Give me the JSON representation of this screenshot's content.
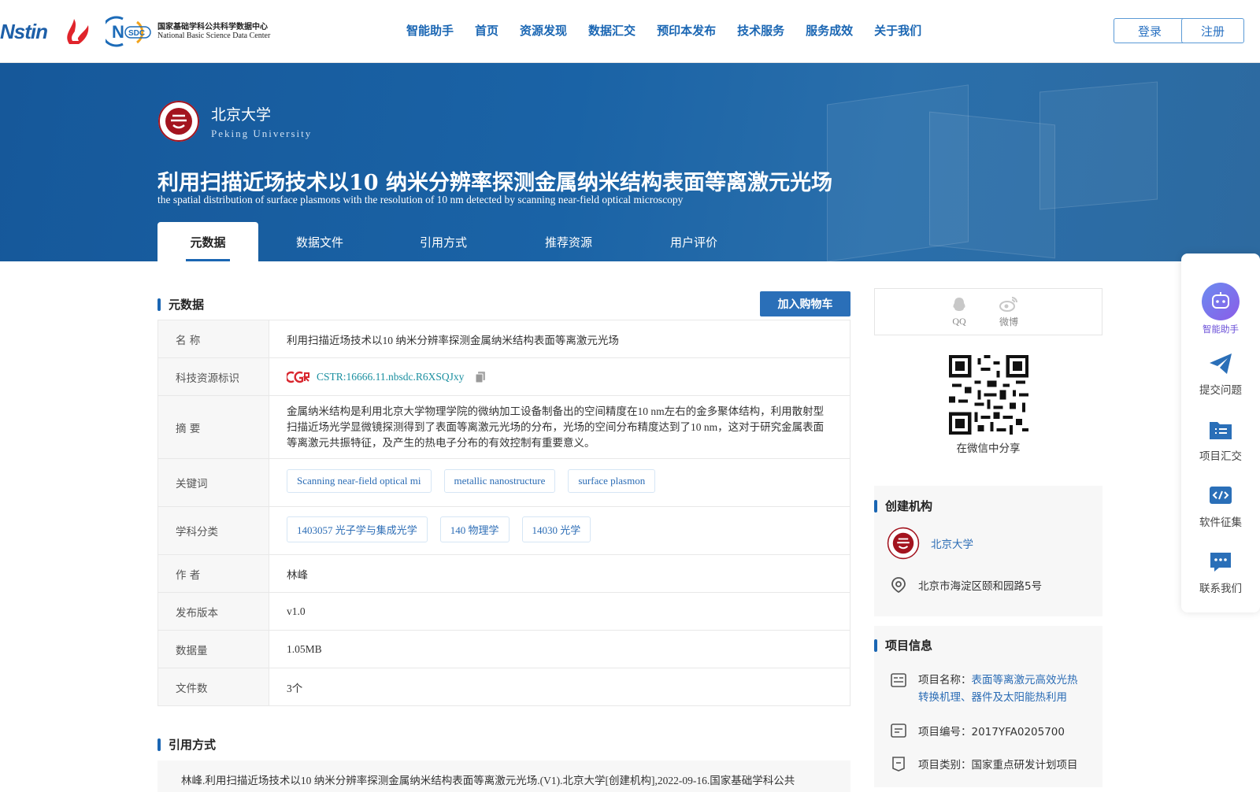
{
  "header": {
    "logo_cstr": "Nstin",
    "logo_nsdc_cn": "国家基础学科公共科学数据中心",
    "logo_nsdc_en": "National Basic Science Data Center",
    "nav": [
      "智能助手",
      "首页",
      "资源发现",
      "数据汇交",
      "预印本发布",
      "技术服务",
      "服务成效",
      "关于我们"
    ],
    "login": "登录",
    "register": "注册"
  },
  "banner": {
    "uni_cn": "北京大学",
    "uni_en": "Peking University",
    "title_cn": "利用扫描近场技术以10 纳米分辨率探测金属纳米结构表面等离激元光场",
    "title_en": "the spatial distribution of surface plasmons with the resolution of 10 nm detected by scanning near-field optical microscopy",
    "tabs": [
      "元数据",
      "数据文件",
      "引用方式",
      "推荐资源",
      "用户评价"
    ]
  },
  "metadata": {
    "section_title": "元数据",
    "cart_button": "加入购物车",
    "name_label": "名 称",
    "name_value": "利用扫描近场技术以10 纳米分辨率探测金属纳米结构表面等离激元光场",
    "id_label": "科技资源标识",
    "id_value": "CSTR:16666.11.nbsdc.R6XSQJxy",
    "abstract_label": "摘 要",
    "abstract_value": "金属纳米结构是利用北京大学物理学院的微纳加工设备制备出的空间精度在10 nm左右的金多聚体结构，利用散射型扫描近场光学显微镜探测得到了表面等离激元光场的分布，光场的空间分布精度达到了10 nm，这对于研究金属表面等离激元共振特征，及产生的热电子分布的有效控制有重要意义。",
    "keywords_label": "关键词",
    "keywords": [
      "Scanning near-field optical mi",
      "metallic nanostructure",
      "surface plasmon"
    ],
    "subjects_label": "学科分类",
    "subjects": [
      "1403057 光子学与集成光学",
      "140 物理学",
      "14030 光学"
    ],
    "author_label": "作 者",
    "author_value": "林峰",
    "version_label": "发布版本",
    "version_value": "v1.0",
    "size_label": "数据量",
    "size_value": "1.05MB",
    "files_label": "文件数",
    "files_value": "3个"
  },
  "citation": {
    "section_title": "引用方式",
    "text": "林峰.利用扫描近场技术以10 纳米分辨率探测金属纳米结构表面等离激元光场.(V1).北京大学[创建机构],2022-09-16.国家基础学科公共"
  },
  "share": {
    "qq": "QQ",
    "weibo": "微博",
    "wechat_caption": "在微信中分享"
  },
  "institution": {
    "section_title": "创建机构",
    "name": "北京大学",
    "address": "北京市海淀区颐和园路5号"
  },
  "project": {
    "section_title": "项目信息",
    "name_label": "项目名称：",
    "name_value": "表面等离激元高效光热转换机理、器件及太阳能热利用",
    "code_label": "项目编号：",
    "code_value": "2017YFA0205700",
    "type_label": "项目类别：",
    "type_value": "国家重点研发计划项目"
  },
  "side": {
    "assistant": "智能助手",
    "submit": "提交问题",
    "project": "项目汇交",
    "software": "软件征集",
    "contact": "联系我们"
  },
  "colors": {
    "primary": "#1a66b3",
    "banner": "#1a63a6",
    "link": "#2b6cb5"
  }
}
